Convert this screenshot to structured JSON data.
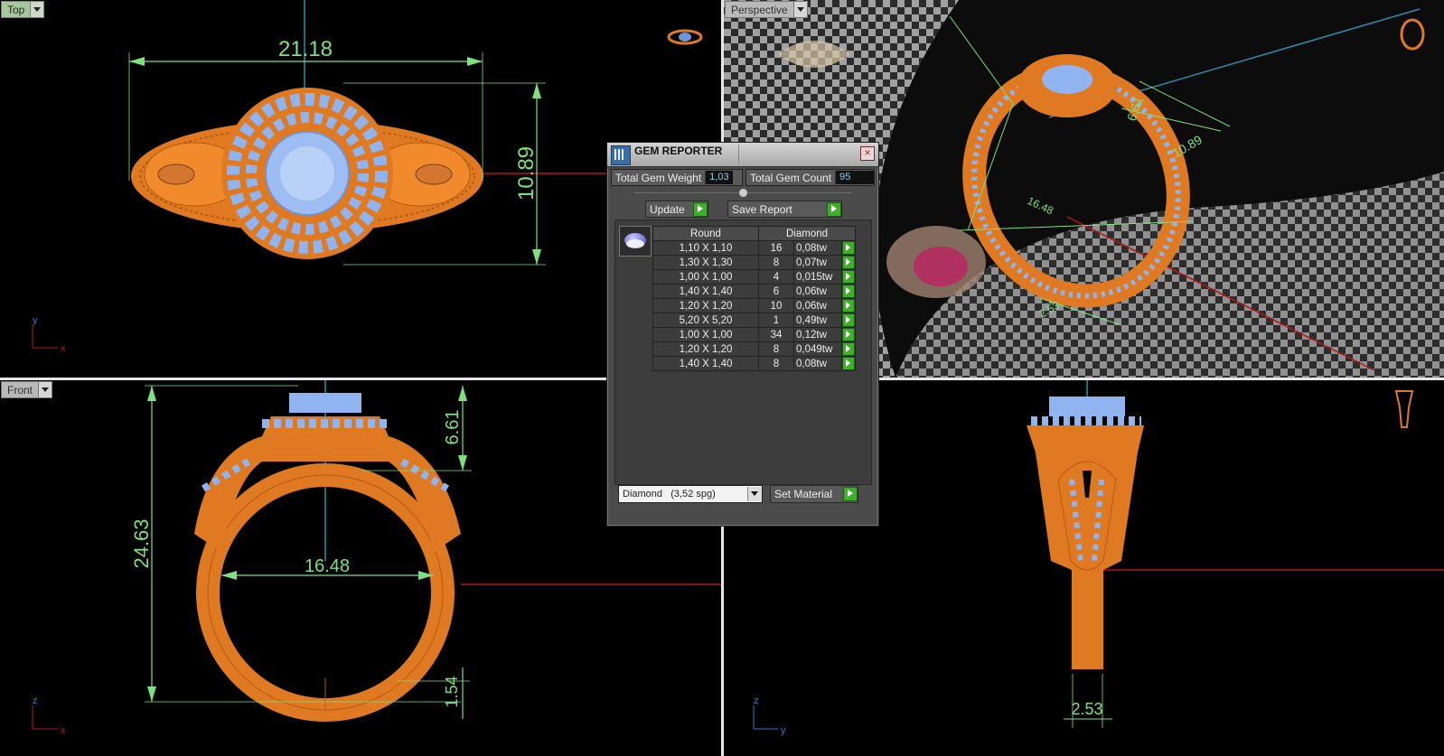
{
  "viewports": {
    "top": {
      "label": "Top",
      "dims": {
        "width": "21.18",
        "height": "10.89"
      },
      "axes": {
        "a": "y",
        "b": "x"
      }
    },
    "perspective": {
      "label": "Perspective",
      "dims": {
        "a": "6.61",
        "b": "10.89",
        "c": "16.48",
        "d": "2.53"
      }
    },
    "front": {
      "label": "Front",
      "dims": {
        "height": "24.63",
        "top": "6.61",
        "inner": "16.48",
        "band": "1.54"
      },
      "axes": {
        "a": "z",
        "b": "x"
      }
    },
    "right": {
      "dims": {
        "band": "2.53"
      },
      "axes": {
        "a": "z",
        "b": "y"
      }
    }
  },
  "gem_reporter": {
    "title": "GEM REPORTER",
    "total_weight_label": "Total Gem Weight",
    "total_weight": "1,03",
    "total_count_label": "Total Gem Count",
    "total_count": "95",
    "update_label": "Update",
    "save_report_label": "Save Report",
    "col_shape": "Round",
    "col_material": "Diamond",
    "rows": [
      {
        "size": "1,10 X 1,10",
        "count": "16",
        "weight": "0,08tw"
      },
      {
        "size": "1,30 X 1,30",
        "count": "8",
        "weight": "0,07tw"
      },
      {
        "size": "1,00 X 1,00",
        "count": "4",
        "weight": "0,015tw"
      },
      {
        "size": "1,40 X 1,40",
        "count": "6",
        "weight": "0,06tw"
      },
      {
        "size": "1,20 X 1,20",
        "count": "10",
        "weight": "0,06tw"
      },
      {
        "size": "5,20 X 5,20",
        "count": "1",
        "weight": "0,49tw"
      },
      {
        "size": "1,00 X 1,00",
        "count": "34",
        "weight": "0,12tw"
      },
      {
        "size": "1,20 X 1,20",
        "count": "8",
        "weight": "0,049tw"
      },
      {
        "size": "1,40 X 1,40",
        "count": "8",
        "weight": "0,08tw"
      }
    ],
    "material": "Diamond",
    "material_density": "(3,52 spg)",
    "set_material_label": "Set Material"
  }
}
